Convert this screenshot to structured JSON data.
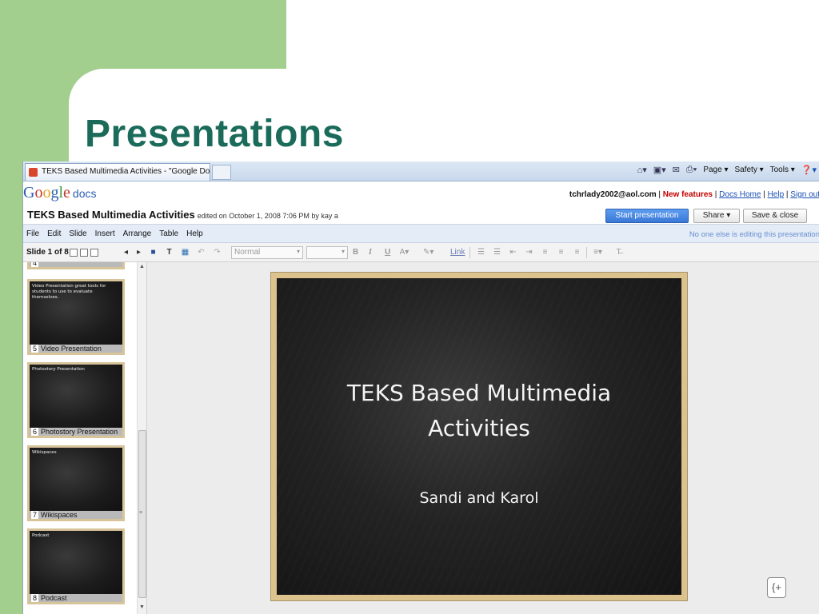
{
  "slide": {
    "title": "Presentations"
  },
  "browser": {
    "tab_title": "TEKS Based Multimedia Activities - \"Google Docs\"",
    "tools": {
      "page": "Page ▾",
      "safety": "Safety ▾",
      "tools": "Tools ▾"
    }
  },
  "gdocs": {
    "logo": {
      "g1": "G",
      "g2": "o",
      "g3": "o",
      "g4": "g",
      "g5": "l",
      "g6": "e",
      "docs": "docs"
    },
    "account": {
      "email": "tchrlady2002@aol.com",
      "sep": " | ",
      "new_features": "New features",
      "docs_home": "Docs Home",
      "help": "Help",
      "sign_out": "Sign out"
    },
    "doc_title": "TEKS Based Multimedia Activities",
    "edited": "edited on October 1, 2008 7:06 PM by kay a",
    "start_presentation": "Start presentation",
    "share": "Share ▾",
    "save_close": "Save & close",
    "menu": [
      "File",
      "Edit",
      "Slide",
      "Insert",
      "Arrange",
      "Table",
      "Help"
    ],
    "editing_note": "No one else is editing this presentation",
    "slide_count": "Slide 1 of 8",
    "toolbar": {
      "style": "Normal",
      "link": "Link",
      "bold": "B",
      "italic": "I",
      "underline": "U"
    }
  },
  "thumbnails": [
    {
      "num": "4",
      "label": "",
      "text": ""
    },
    {
      "num": "5",
      "label": "Video Presentation",
      "text": "Video Presentation great tools for students to use to evaluate themselves."
    },
    {
      "num": "6",
      "label": "Photostory Presentation",
      "text": "Photostory Presentation"
    },
    {
      "num": "7",
      "label": "Wikispaces",
      "text": "Wikispaces"
    },
    {
      "num": "8",
      "label": "Podcast",
      "text": "Podcast"
    }
  ],
  "current_slide": {
    "title_line1": "TEKS Based Multimedia",
    "title_line2": "Activities",
    "subtitle": "Sandi and Karol"
  },
  "colors": {
    "green": "#a3cf8e",
    "title_teal": "#1b6b5a",
    "start_blue": "#3a78d6",
    "frame_gold": "#dcc28c"
  }
}
